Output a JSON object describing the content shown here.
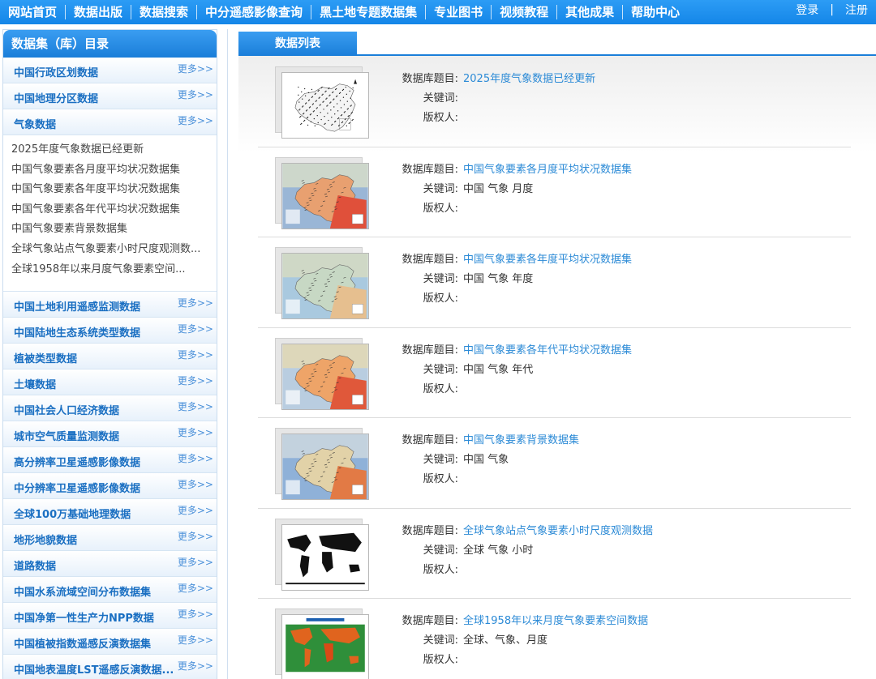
{
  "nav": {
    "items": [
      "网站首页",
      "数据出版",
      "数据搜索",
      "中分遥感影像查询",
      "黑土地专题数据集",
      "专业图书",
      "视频教程",
      "其他成果",
      "帮助中心"
    ],
    "login": "登录",
    "separator": "|",
    "register": "注册"
  },
  "sidebar": {
    "title": "数据集（库）目录",
    "more_label": "更多>>",
    "categories_top": [
      "中国行政区划数据",
      "中国地理分区数据",
      "气象数据"
    ],
    "sub_items": [
      "2025年度气象数据已经更新",
      "中国气象要素各月度平均状况数据集",
      "中国气象要素各年度平均状况数据集",
      "中国气象要素各年代平均状况数据集",
      "中国气象要素背景数据集",
      "全球气象站点气象要素小时尺度观测数...",
      "全球1958年以来月度气象要素空间..."
    ],
    "categories_bottom": [
      "中国土地利用遥感监测数据",
      "中国陆地生态系统类型数据",
      "植被类型数据",
      "土壤数据",
      "中国社会人口经济数据",
      "城市空气质量监测数据",
      "高分辨率卫星遥感影像数据",
      "中分辨率卫星遥感影像数据",
      "全球100万基础地理数据",
      "地形地貌数据",
      "道路数据",
      "中国水系流域空间分布数据集",
      "中国净第一性生产力NPP数据",
      "中国植被指数遥感反演数据集",
      "中国地表温度LST遥感反演数据..."
    ]
  },
  "main": {
    "tab": "数据列表",
    "labels": {
      "title": "数据库题目:",
      "keywords": "关键词:",
      "owner": "版权人:"
    },
    "entries": [
      {
        "title": "2025年度气象数据已经更新",
        "keywords": "",
        "owner": "",
        "thumb": "china-station-map"
      },
      {
        "title": "中国气象要素各月度平均状况数据集",
        "keywords": "中国 气象 月度",
        "owner": "",
        "thumb": "china-climate-map-red"
      },
      {
        "title": "中国气象要素各年度平均状况数据集",
        "keywords": "中国 气象 年度",
        "owner": "",
        "thumb": "china-climate-map-teal"
      },
      {
        "title": "中国气象要素各年代平均状况数据集",
        "keywords": "中国 气象 年代",
        "owner": "",
        "thumb": "china-climate-map-orange"
      },
      {
        "title": "中国气象要素背景数据集",
        "keywords": "中国 气象",
        "owner": "",
        "thumb": "china-climate-map-blue"
      },
      {
        "title": "全球气象站点气象要素小时尺度观测数据",
        "keywords": "全球 气象 小时",
        "owner": "",
        "thumb": "world-station-map"
      },
      {
        "title": "全球1958年以来月度气象要素空间数据",
        "keywords": "全球、气象、月度",
        "owner": "",
        "thumb": "world-climate-map"
      }
    ]
  },
  "colors": {
    "nav_bg": "#1486e8",
    "link": "#2b8ad6",
    "category_text": "#1a6fc2"
  }
}
